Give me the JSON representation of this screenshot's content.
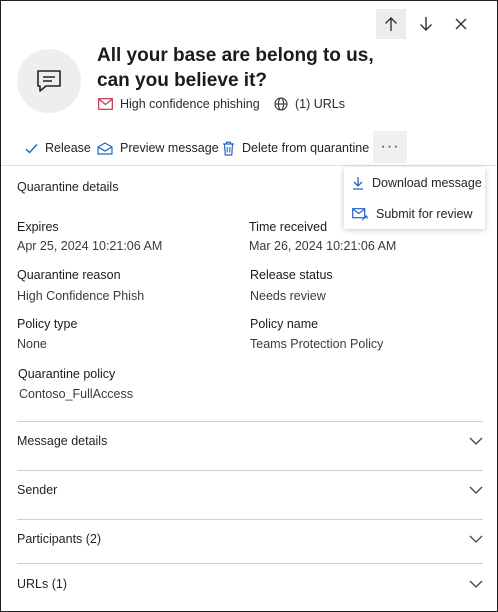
{
  "header": {
    "title": "All your base are belong to us, can you believe it?",
    "threat": "High confidence phishing",
    "urls": "(1) URLs"
  },
  "toolbar": {
    "release": "Release",
    "preview": "Preview message",
    "delete": "Delete from quarantine",
    "more": "···"
  },
  "menu": {
    "download": "Download message",
    "submit": "Submit for review"
  },
  "details": {
    "section_title": "Quarantine details",
    "expires_label": "Expires",
    "expires_value": "Apr 25, 2024 10:21:06 AM",
    "received_label": "Time received",
    "received_value": "Mar 26, 2024 10:21:06 AM",
    "reason_label": "Quarantine reason",
    "reason_value": "High Confidence Phish",
    "release_status_label": "Release status",
    "release_status_value": "Needs review",
    "policy_type_label": "Policy type",
    "policy_type_value": "None",
    "policy_name_label": "Policy name",
    "policy_name_value": "Teams Protection Policy",
    "quarantine_policy_label": "Quarantine policy",
    "quarantine_policy_value": "Contoso_FullAccess"
  },
  "sections": {
    "message_details": "Message details",
    "sender": "Sender",
    "participants": "Participants (2)",
    "urls": "URLs (1)"
  }
}
